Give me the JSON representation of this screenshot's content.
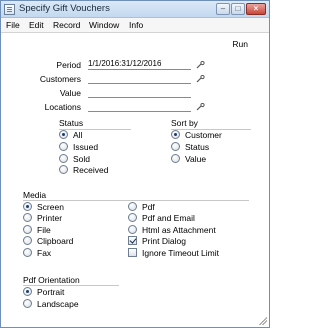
{
  "window": {
    "title": "Specify Gift Vouchers"
  },
  "menu": {
    "items": [
      "File",
      "Edit",
      "Record",
      "Window",
      "Info"
    ]
  },
  "toolbar": {
    "run_label": "Run"
  },
  "fields": {
    "period": {
      "label": "Period",
      "value": "1/1/2016:31/12/2016"
    },
    "customers": {
      "label": "Customers",
      "value": ""
    },
    "value": {
      "label": "Value",
      "value": ""
    },
    "locations": {
      "label": "Locations",
      "value": ""
    }
  },
  "status": {
    "title": "Status",
    "options": [
      "All",
      "Issued",
      "Sold",
      "Received"
    ],
    "selected": "All"
  },
  "sort_by": {
    "title": "Sort by",
    "options": [
      "Customer",
      "Status",
      "Value"
    ],
    "selected": "Customer"
  },
  "media": {
    "title": "Media",
    "left_options": [
      "Screen",
      "Printer",
      "File",
      "Clipboard",
      "Fax"
    ],
    "right_options": [
      "Pdf",
      "Pdf and Email",
      "Html as Attachment"
    ],
    "selected": "Screen",
    "checkboxes": [
      {
        "label": "Print Dialog",
        "checked": true
      },
      {
        "label": "Ignore Timeout Limit",
        "checked": false
      }
    ]
  },
  "pdf_orientation": {
    "title": "Pdf Orientation",
    "options": [
      "Portrait",
      "Landscape"
    ],
    "selected": "Portrait"
  }
}
